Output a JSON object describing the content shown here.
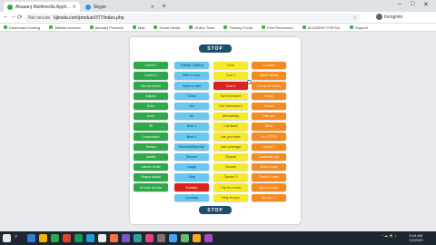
{
  "browser": {
    "tabs": [
      {
        "title": "Akaaanj Multimedia Appli...",
        "favicon_color": "#2ea84a",
        "active": true
      },
      {
        "title": "Skype",
        "favicon_color": "#1ba1e2",
        "active": false
      }
    ],
    "new_tab_glyph": "+",
    "window_controls": [
      "–",
      "□",
      "✕"
    ],
    "nav": {
      "back": "←",
      "forward": "→",
      "reload": "⟳"
    },
    "security_label": "Not secure",
    "url": "kjlesda.com/product/377/index.php",
    "profile_name": "Incognito",
    "bookmarks": [
      "Dashboard Hosting",
      "Affiliate Account",
      "Akaaanj Products",
      "Mail",
      "Social Media",
      "Online Tools",
      "Training Portal",
      "Free Resources",
      "ACADEMY PORTAL",
      "Support"
    ]
  },
  "page": {
    "stop_label": "STOP",
    "columns": [
      {
        "color": "green",
        "items": [
          "Lorem 1",
          "Lorem 2",
          "Sed do eiusm",
          "Adipisc",
          "Dolor",
          "Amet",
          "Sit",
          "Consectetur",
          "Tempor",
          "Incidid",
          "Labore et dol",
          "Magna aliqua",
          "Ut enim ad min"
        ]
      },
      {
        "color": "blue",
        "items": [
          "Thanks / Asking",
          "Well in Hour",
          "Voice in later",
          "Great",
          "Yes",
          "No",
          "Best 1",
          "Best 2",
          "Remodel/Bye/Hai",
          "Shower",
          "Laugh",
          "Sing",
          "Transfer",
          "Goodbye"
        ]
      },
      {
        "color": "yellow",
        "items": [
          "Ocal",
          "Cool 1",
          "Cool 2",
          "Not Interested",
          "Not Interested 2",
          "Affordability",
          "Call Back",
          "Are you there",
          "Add coverage",
          "Repeat",
          "Gender",
          "Gender 2",
          "Cry for Loved",
          "Help for you"
        ]
      },
      {
        "color": "orange",
        "items": [
          "Location",
          "Rapid Stress",
          "Computer Items",
          "Email",
          "Hours",
          "Pain yes",
          "Bites",
          "No HTTPS",
          "Verbal 1",
          "Landlords Age",
          "Water Dogs",
          "Check & uses",
          "Back to ease",
          "Bio and 's"
        ]
      }
    ],
    "highlighted": [
      {
        "column": 2,
        "index": 2
      },
      {
        "column": 1,
        "index": 12
      }
    ]
  },
  "taskbar": {
    "search_glyph": "⌕",
    "apps": [
      "#3a7bd5",
      "#f4b400",
      "#2ea84a",
      "#db4437",
      "#0f9d58",
      "#1ba1e2",
      "#e9e9e9",
      "#ff7043",
      "#7e57c2",
      "#26a69a",
      "#ec407a",
      "#8d6e63",
      "#42a5f5",
      "#66bb6a",
      "#ffa726",
      "#ab47bc"
    ],
    "tray": "^ ☁ ⚡ ♪",
    "time": "5:44 AM",
    "date": "7/2/2020"
  }
}
